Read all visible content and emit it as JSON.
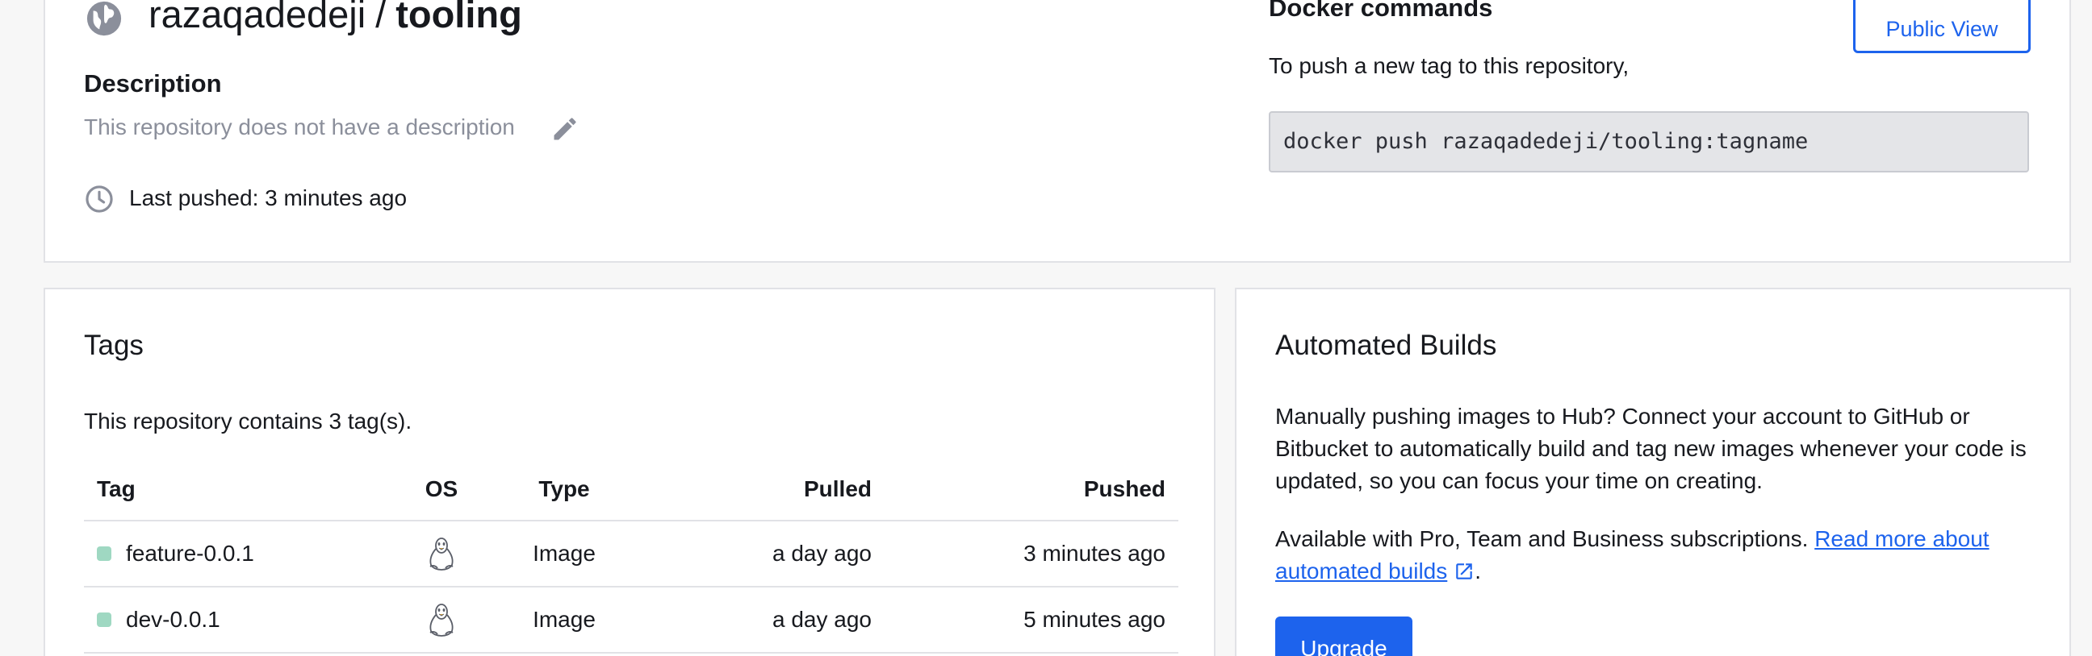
{
  "repo": {
    "namespace": "razaqadedeji",
    "separator": "/",
    "name": "tooling",
    "visibility_icon": "globe-icon",
    "description_heading": "Description",
    "description_text": "This repository does not have a description",
    "last_pushed": "Last pushed: 3 minutes ago"
  },
  "docker": {
    "heading": "Docker commands",
    "subtext": "To push a new tag to this repository,",
    "command": "docker push razaqadedeji/tooling:tagname",
    "public_view_label": "Public View"
  },
  "tags": {
    "heading": "Tags",
    "count_text": "This repository contains 3 tag(s).",
    "columns": [
      "Tag",
      "OS",
      "Type",
      "Pulled",
      "Pushed"
    ],
    "rows": [
      {
        "tag": "feature-0.0.1",
        "os": "linux-icon",
        "type": "Image",
        "pulled": "a day ago",
        "pushed": "3 minutes ago"
      },
      {
        "tag": "dev-0.0.1",
        "os": "linux-icon",
        "type": "Image",
        "pulled": "a day ago",
        "pushed": "5 minutes ago"
      }
    ]
  },
  "builds": {
    "heading": "Automated Builds",
    "text": "Manually pushing images to Hub? Connect your account to GitHub or Bitbucket to automatically build and tag new images whenever your code is updated, so you can focus your time on creating.",
    "availability": "Available with Pro, Team and Business subscriptions.",
    "link_text": "Read more about automated builds",
    "link_suffix": ".",
    "upgrade_label": "Upgrade"
  },
  "colors": {
    "accent": "#1d63ed",
    "tag_status": "#9fd8c2",
    "muted_text": "#8b8f9b",
    "code_bg": "#e4e5e8"
  }
}
